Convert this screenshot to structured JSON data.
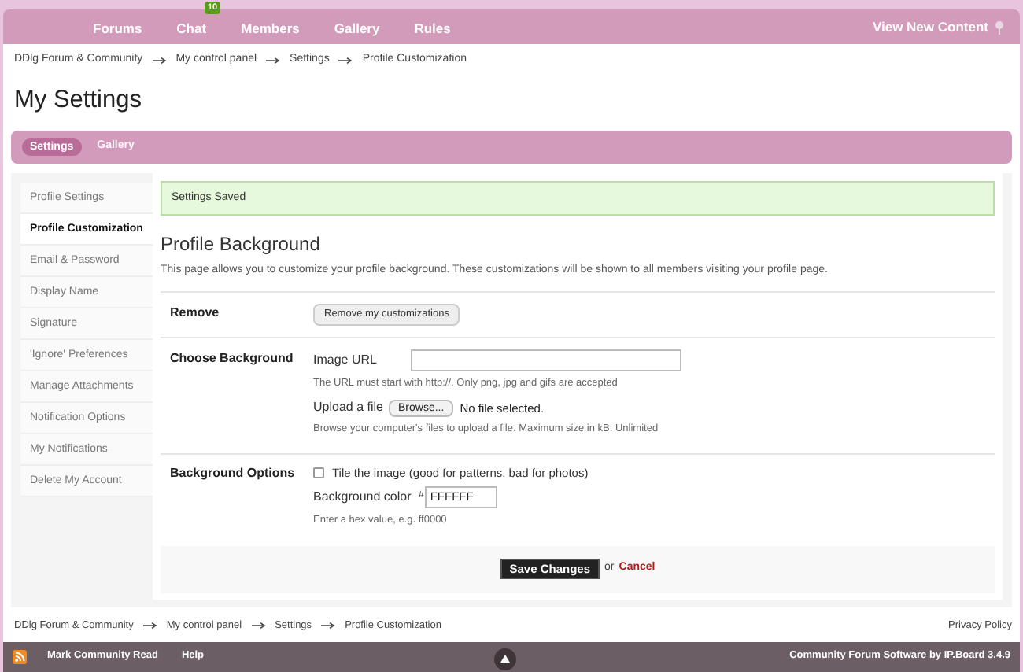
{
  "nav": {
    "items": [
      {
        "label": "Forums"
      },
      {
        "label": "Chat",
        "badge": "10"
      },
      {
        "label": "Members"
      },
      {
        "label": "Gallery"
      },
      {
        "label": "Rules"
      }
    ],
    "right_link": "View New Content"
  },
  "breadcrumb_top": [
    "DDlg Forum & Community",
    "My control panel",
    "Settings",
    "Profile Customization"
  ],
  "page_title": "My Settings",
  "tabs": [
    {
      "label": "Settings",
      "selected": true
    },
    {
      "label": "Gallery",
      "selected": false
    }
  ],
  "sidebar": {
    "items": [
      {
        "label": "Profile Settings",
        "selected": false
      },
      {
        "label": "Profile Customization",
        "selected": true
      },
      {
        "label": "Email & Password",
        "selected": false
      },
      {
        "label": "Display Name",
        "selected": false
      },
      {
        "label": "Signature",
        "selected": false
      },
      {
        "label": "'Ignore' Preferences",
        "selected": false
      },
      {
        "label": "Manage Attachments",
        "selected": false
      },
      {
        "label": "Notification Options",
        "selected": false
      },
      {
        "label": "My Notifications",
        "selected": false
      },
      {
        "label": "Delete My Account",
        "selected": false
      }
    ]
  },
  "message": "Settings Saved",
  "section": {
    "title": "Profile Background",
    "description": "This page allows you to customize your profile background. These customizations will be shown to all members visiting your profile page."
  },
  "remove": {
    "label": "Remove",
    "button": "Remove my customizations"
  },
  "choose": {
    "label": "Choose Background",
    "url_label": "Image URL",
    "url_hint": "The URL must start with http://. Only png, jpg and gifs are accepted",
    "upload_label": "Upload a file",
    "browse_button": "Browse...",
    "file_status": "No file selected.",
    "upload_hint": "Browse your computer's files to upload a file. Maximum size in kB: Unlimited"
  },
  "options": {
    "label": "Background Options",
    "tile_label": "Tile the image (good for patterns, bad for photos)",
    "tile_checked": false,
    "color_label": "Background color",
    "hash": "#",
    "color_value": "FFFFFF",
    "color_hint": "Enter a hex value, e.g. ff0000"
  },
  "actions": {
    "save": "Save Changes",
    "or": "or",
    "cancel": "Cancel"
  },
  "breadcrumb_bottom": [
    "DDlg Forum & Community",
    "My control panel",
    "Settings",
    "Profile Customization"
  ],
  "privacy": "Privacy Policy",
  "footer": {
    "links": [
      "Mark Community Read",
      "Help"
    ],
    "credit": "Community Forum Software by IP.Board 3.4.9"
  }
}
